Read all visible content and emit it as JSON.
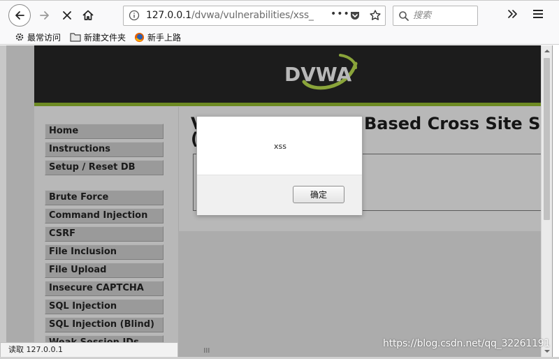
{
  "browser": {
    "url_host": "127.0.0.1",
    "url_path": "/dvwa/vulnerabilities/xss_",
    "search_placeholder": "搜索",
    "bookmarks": [
      {
        "label": "最常访问",
        "icon": "gear-icon"
      },
      {
        "label": "新建文件夹",
        "icon": "folder-icon"
      },
      {
        "label": "新手上路",
        "icon": "firefox-icon"
      }
    ],
    "status_text": "读取 127.0.0.1"
  },
  "dvwa": {
    "logo_text": "DVWA",
    "menu_group_1": [
      "Home",
      "Instructions",
      "Setup / Reset DB"
    ],
    "menu_group_2": [
      "Brute Force",
      "Command Injection",
      "CSRF",
      "File Inclusion",
      "File Upload",
      "Insecure CAPTCHA",
      "SQL Injection",
      "SQL Injection (Blind)",
      "Weak Session IDs"
    ],
    "title_visible_left": "V",
    "title_visible_left_line2": "(",
    "title_visible_right": "Based Cross Site Scr",
    "brand_green": "#6d8a23"
  },
  "alert": {
    "message": "xss",
    "ok_label": "确定"
  },
  "watermark": "https://blog.csdn.net/qq_32261191"
}
